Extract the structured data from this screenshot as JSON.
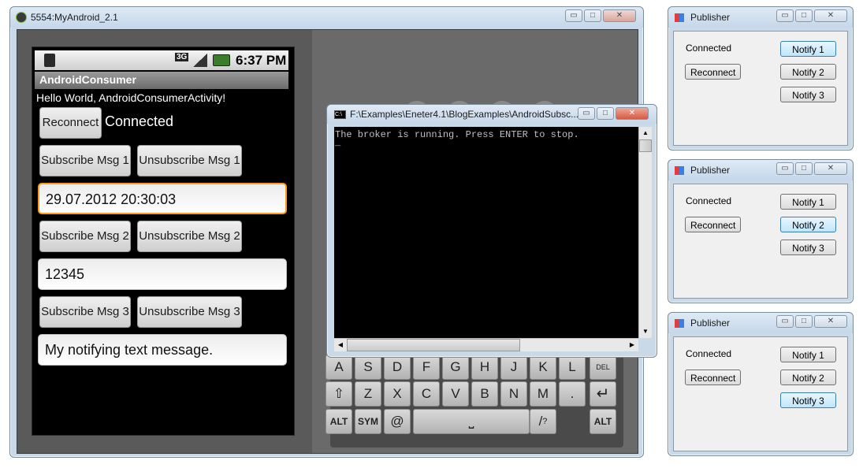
{
  "emulator": {
    "title": "5554:MyAndroid_2.1",
    "status_time": "6:37 PM",
    "net_label": "3G",
    "app_title": "AndroidConsumer",
    "hello_text": "Hello World, AndroidConsumerActivity!",
    "reconnect_label": "Reconnect",
    "connected_text": "Connected",
    "subscribe1": "Subscribe Msg 1",
    "unsubscribe1": "Unsubscribe Msg 1",
    "field1": "29.07.2012 20:30:03",
    "subscribe2": "Subscribe Msg 2",
    "unsubscribe2": "Unsubscribe Msg 2",
    "field2": "12345",
    "subscribe3": "Subscribe Msg 3",
    "unsubscribe3": "Unsubscribe Msg 3",
    "field3": "My notifying text message.",
    "keyboard": {
      "row1": [
        "A",
        "S",
        "D",
        "F",
        "G",
        "H",
        "J",
        "K",
        "L"
      ],
      "row2": [
        "Z",
        "X",
        "C",
        "V",
        "B",
        "N",
        "M",
        "."
      ],
      "alt_label": "ALT",
      "sym_label": "SYM",
      "at_label": "@",
      "slash_label": "/",
      "question_label": "?",
      "del_label": "DEL"
    }
  },
  "console": {
    "title": "F:\\Examples\\Eneter4.1\\BlogExamples\\AndroidSubsc...",
    "output": "The broker is running. Press ENTER to stop.",
    "cursor": "_"
  },
  "publishers": [
    {
      "title": "Publisher",
      "status": "Connected",
      "reconnect": "Reconnect",
      "notify1": "Notify 1",
      "notify2": "Notify 2",
      "notify3": "Notify 3",
      "focused": 1
    },
    {
      "title": "Publisher",
      "status": "Connected",
      "reconnect": "Reconnect",
      "notify1": "Notify 1",
      "notify2": "Notify 2",
      "notify3": "Notify 3",
      "focused": 2
    },
    {
      "title": "Publisher",
      "status": "Connected",
      "reconnect": "Reconnect",
      "notify1": "Notify 1",
      "notify2": "Notify 2",
      "notify3": "Notify 3",
      "focused": 3
    }
  ],
  "window_buttons": {
    "minimize": "▭",
    "maximize": "□",
    "close": "✕"
  },
  "colors": {
    "accent_focus": "#ff9a1f",
    "console_bg": "#000000",
    "console_text": "#c0c0c0"
  }
}
